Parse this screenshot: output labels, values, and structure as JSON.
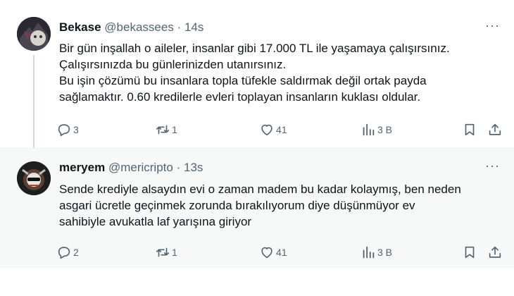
{
  "tweets": [
    {
      "display_name": "Bekase",
      "handle": "@bekassees",
      "separator": "·",
      "time": "14s",
      "more_label": "···",
      "lines": [
        "Bir gün inşallah o aileler, insanlar gibi 17.000 TL ile yaşamaya çalışırsınız.",
        "Çalışırsınızda bu günlerinizden utanırsınız.",
        "Bu işin çözümü bu insanlara topla tüfekle saldırmak değil ortak payda",
        "sağlamaktır. 0.60 kredilerle evleri toplayan insanların kuklası oldular."
      ],
      "replies": "3",
      "reposts": "1",
      "likes": "41",
      "views": "3 B"
    },
    {
      "display_name": "meryem",
      "handle": "@mericripto",
      "separator": "·",
      "time": "13s",
      "more_label": "···",
      "lines": [
        "Sende krediyle alsaydın evi o zaman madem bu kadar kolaymış, ben neden",
        "asgari ücretle geçinmek zorunda bırakılıyorum diye düşünmüyor ev",
        "sahibiyle avukatla laf yarışına giriyor"
      ],
      "replies": "2",
      "reposts": "1",
      "likes": "41",
      "views": "3 B"
    }
  ],
  "icons": {
    "reply": "speech-bubble-icon",
    "repost": "repost-arrows-icon",
    "like": "heart-icon",
    "views": "bar-chart-icon",
    "bookmark": "bookmark-icon",
    "share": "share-arrow-icon"
  },
  "colors": {
    "text": "#0f1419",
    "secondary": "#536471",
    "thread_line": "#cfd9de",
    "highlight_bg": "#f7f9f9"
  }
}
